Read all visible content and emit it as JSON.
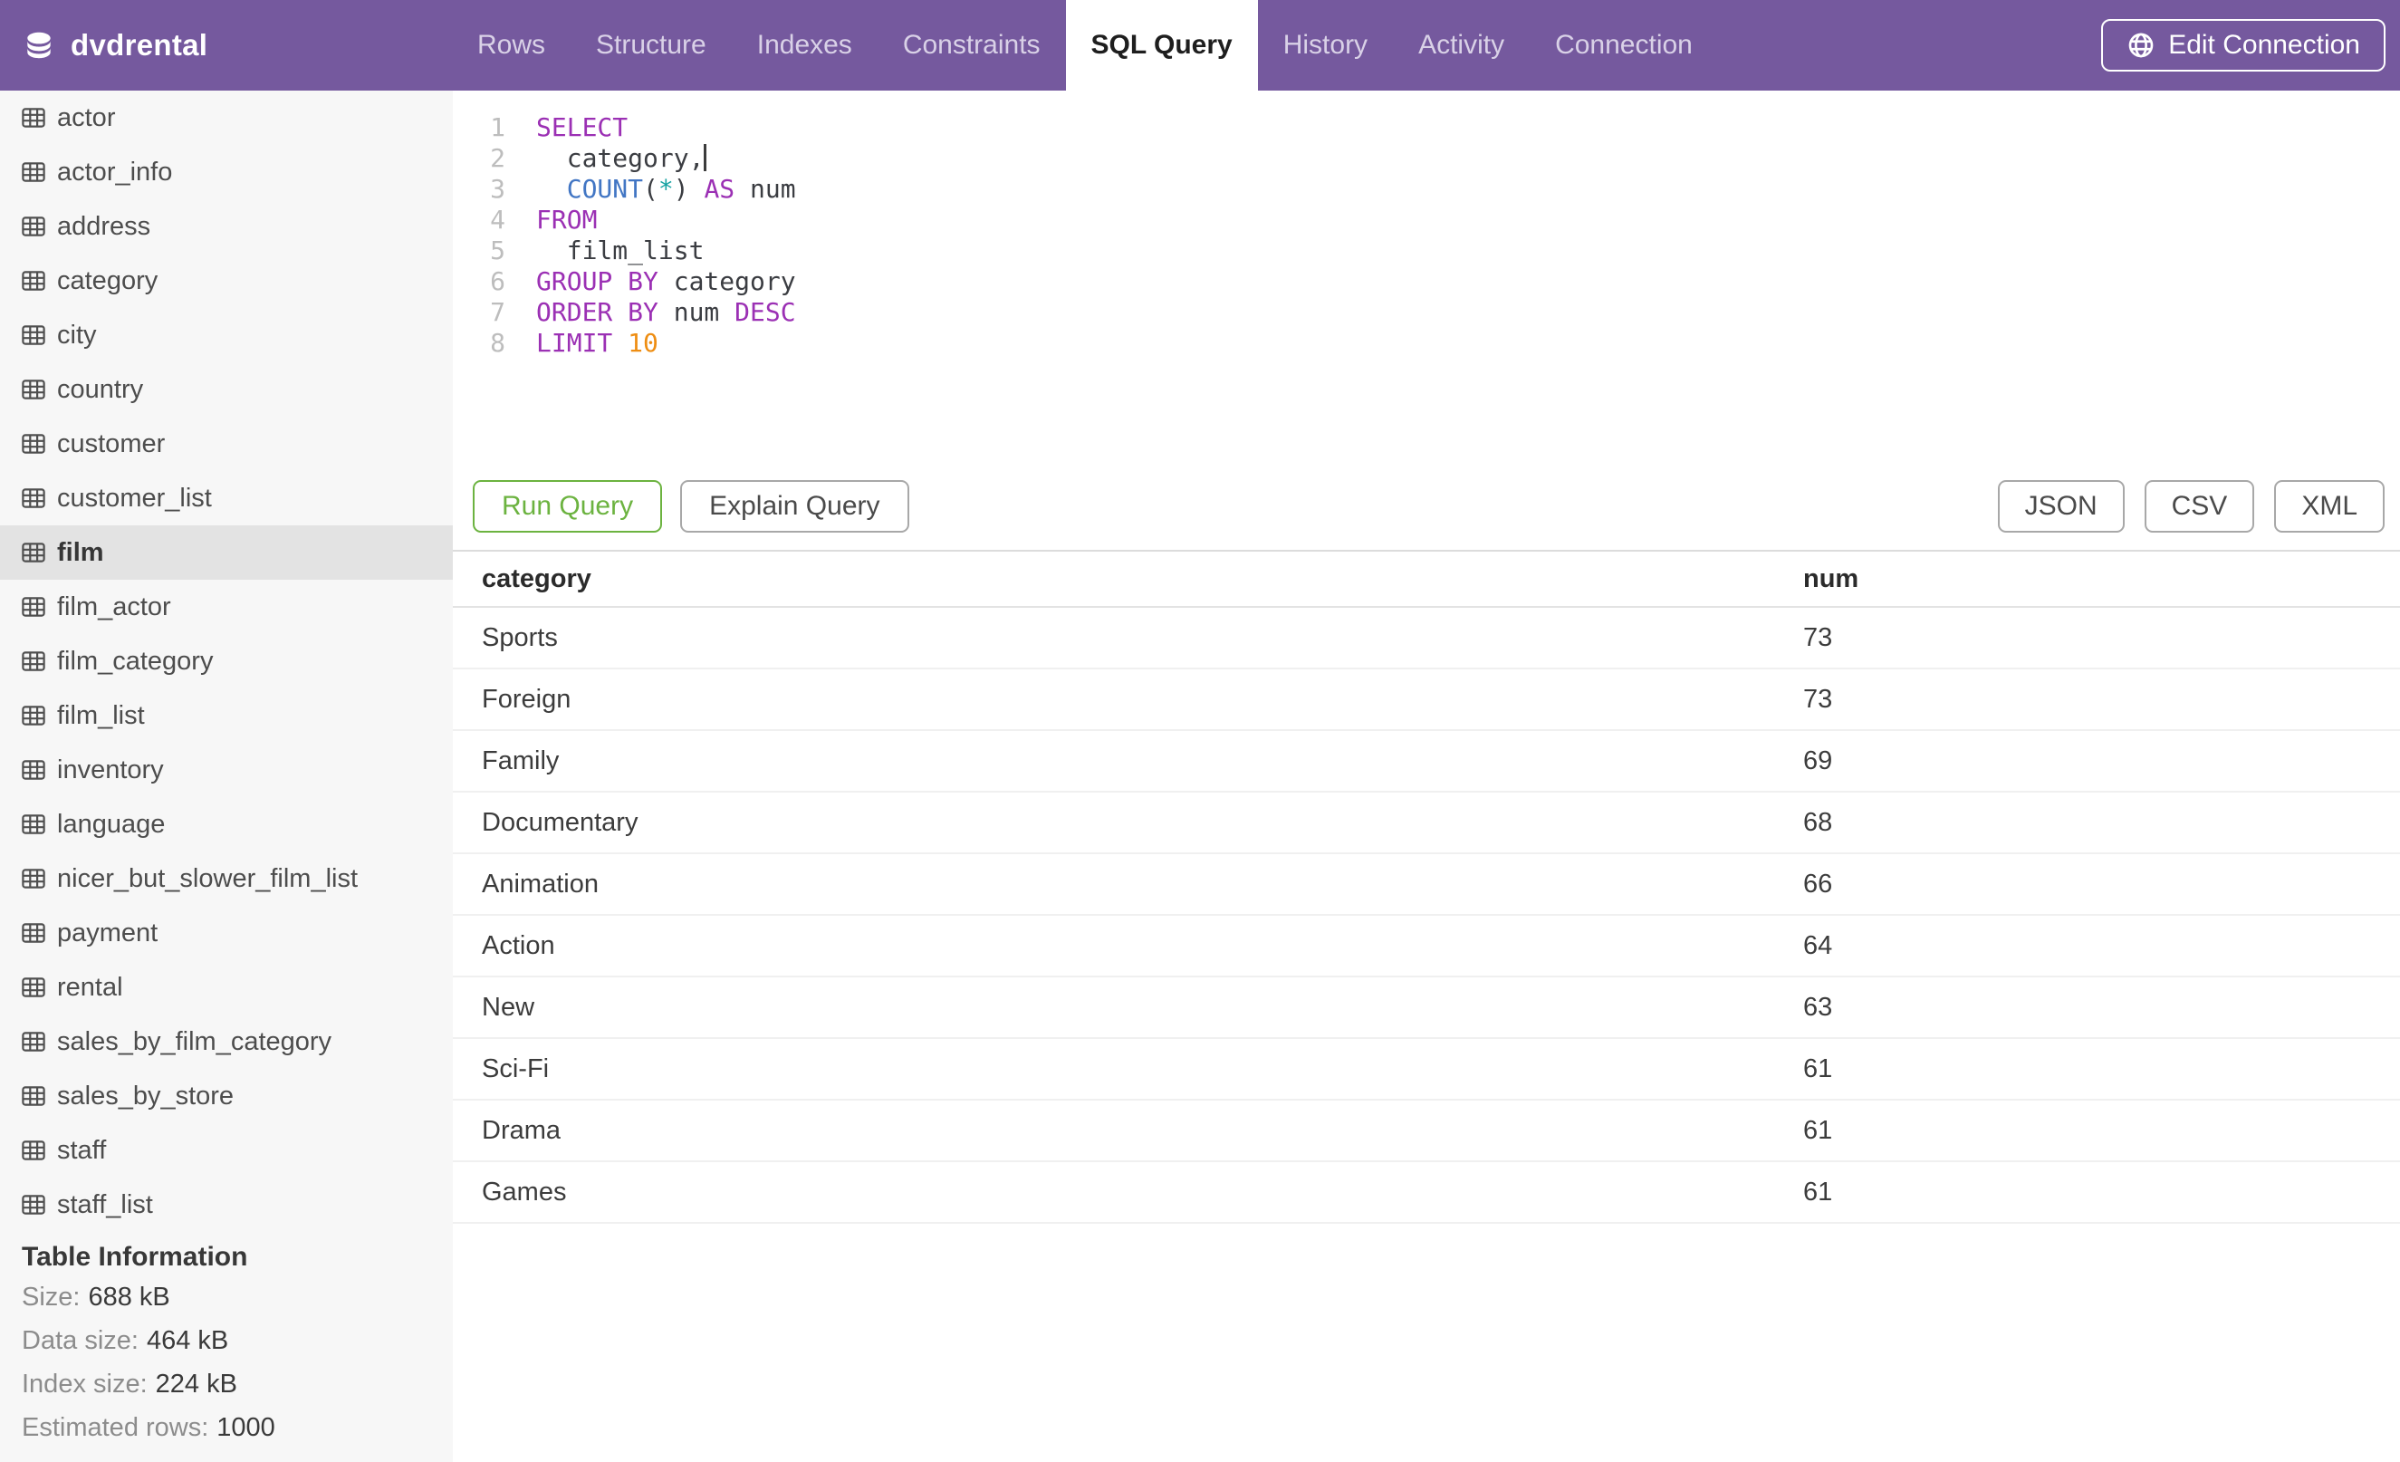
{
  "app": {
    "database_title": "dvdrental",
    "colors": {
      "header_purple": "#75599E",
      "accent_green": "#6CB340",
      "sql_keyword": "#9B30B4",
      "sql_function": "#4276C4",
      "sql_number": "#EE8D12"
    }
  },
  "nav": {
    "tabs": [
      {
        "label": "Rows",
        "active": false
      },
      {
        "label": "Structure",
        "active": false
      },
      {
        "label": "Indexes",
        "active": false
      },
      {
        "label": "Constraints",
        "active": false
      },
      {
        "label": "SQL Query",
        "active": true
      },
      {
        "label": "History",
        "active": false
      },
      {
        "label": "Activity",
        "active": false
      },
      {
        "label": "Connection",
        "active": false
      }
    ],
    "edit_connection_label": "Edit Connection"
  },
  "sidebar": {
    "tables": [
      "actor",
      "actor_info",
      "address",
      "category",
      "city",
      "country",
      "customer",
      "customer_list",
      "film",
      "film_actor",
      "film_category",
      "film_list",
      "inventory",
      "language",
      "nicer_but_slower_film_list",
      "payment",
      "rental",
      "sales_by_film_category",
      "sales_by_store",
      "staff",
      "staff_list"
    ],
    "selected_table": "film",
    "table_information": {
      "heading": "Table Information",
      "stats": [
        {
          "label": "Size:",
          "value": "688 kB"
        },
        {
          "label": "Data size:",
          "value": "464 kB"
        },
        {
          "label": "Index size:",
          "value": "224 kB"
        },
        {
          "label": "Estimated rows:",
          "value": "1000"
        }
      ]
    }
  },
  "editor": {
    "lines": [
      {
        "number": "1",
        "tokens": [
          {
            "text": "SELECT",
            "type": "kw"
          }
        ]
      },
      {
        "number": "2",
        "tokens": [
          {
            "text": "  category,",
            "type": "plain"
          },
          {
            "text": "",
            "type": "caret"
          }
        ]
      },
      {
        "number": "3",
        "tokens": [
          {
            "text": "  ",
            "type": "plain"
          },
          {
            "text": "COUNT",
            "type": "fn"
          },
          {
            "text": "(",
            "type": "plain"
          },
          {
            "text": "*",
            "type": "star"
          },
          {
            "text": ") ",
            "type": "plain"
          },
          {
            "text": "AS",
            "type": "kw"
          },
          {
            "text": " num",
            "type": "plain"
          }
        ]
      },
      {
        "number": "4",
        "tokens": [
          {
            "text": "FROM",
            "type": "kw"
          }
        ]
      },
      {
        "number": "5",
        "tokens": [
          {
            "text": "  film_list",
            "type": "plain"
          }
        ]
      },
      {
        "number": "6",
        "tokens": [
          {
            "text": "GROUP BY",
            "type": "kw"
          },
          {
            "text": " category",
            "type": "plain"
          }
        ]
      },
      {
        "number": "7",
        "tokens": [
          {
            "text": "ORDER BY",
            "type": "kw"
          },
          {
            "text": " num ",
            "type": "plain"
          },
          {
            "text": "DESC",
            "type": "kw"
          }
        ]
      },
      {
        "number": "8",
        "tokens": [
          {
            "text": "LIMIT",
            "type": "kw"
          },
          {
            "text": " ",
            "type": "plain"
          },
          {
            "text": "10",
            "type": "num"
          }
        ]
      }
    ]
  },
  "toolbar": {
    "run_label": "Run Query",
    "explain_label": "Explain Query",
    "export_formats": [
      "JSON",
      "CSV",
      "XML"
    ]
  },
  "results": {
    "columns": [
      "category",
      "num"
    ],
    "rows": [
      [
        "Sports",
        "73"
      ],
      [
        "Foreign",
        "73"
      ],
      [
        "Family",
        "69"
      ],
      [
        "Documentary",
        "68"
      ],
      [
        "Animation",
        "66"
      ],
      [
        "Action",
        "64"
      ],
      [
        "New",
        "63"
      ],
      [
        "Sci-Fi",
        "61"
      ],
      [
        "Drama",
        "61"
      ],
      [
        "Games",
        "61"
      ]
    ]
  }
}
